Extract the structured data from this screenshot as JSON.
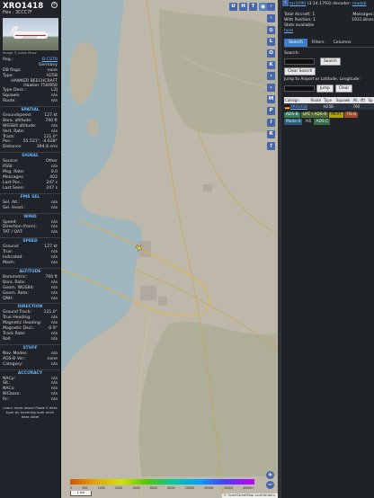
{
  "aircraft": {
    "callsign": "XRO1418",
    "hex_label": "Hex : 3CCC7F",
    "photo_credit": "Image © Julian Muse",
    "details": [
      {
        "k": "Reg.:",
        "v": "D-CSTB",
        "link": true
      },
      {
        "k": "",
        "v": "Germany"
      },
      {
        "k": "DB flags:",
        "v": "none"
      },
      {
        "k": "Type:",
        "v": "H25B"
      }
    ],
    "type_desc_line1": "HAWKER BEECHCRAFT",
    "type_desc_line2": "Hawker 750/850",
    "details2": [
      {
        "k": "Type Desc.:",
        "v": "L2J"
      },
      {
        "k": "Squawk:",
        "v": "n/a"
      },
      {
        "k": "Route:",
        "v": "n/a"
      }
    ]
  },
  "sections": [
    {
      "title": "SPATIAL",
      "rows": [
        {
          "k": "Groundspeed:",
          "v": "127 kt"
        },
        {
          "k": "Baro. altitude:",
          "v": "700 ft"
        },
        {
          "k": "WGS84 altitude:",
          "v": "n/a"
        },
        {
          "k": "Vert. Rate:",
          "v": "n/a"
        },
        {
          "k": "Track:",
          "v": "121.0°"
        },
        {
          "k": "Pos.:",
          "v": "55.521°, -4.628°"
        },
        {
          "k": "Distance:",
          "v": "394.8 nmi"
        }
      ]
    },
    {
      "title": "SIGNAL",
      "rows": [
        {
          "k": "Source:",
          "v": "Other"
        },
        {
          "k": "RSSI:",
          "v": "n/a"
        },
        {
          "k": "Msg. Rate:",
          "v": "0.0"
        },
        {
          "k": "Messages:",
          "v": "402"
        },
        {
          "k": "Last Pos.:",
          "v": "247 s"
        },
        {
          "k": "Last Seen:",
          "v": "247 s"
        }
      ]
    },
    {
      "title": "FMS SEL",
      "rows": [
        {
          "k": "Sel. Alt.:",
          "v": "n/a"
        },
        {
          "k": "Sel. Head.:",
          "v": "n/a"
        }
      ]
    },
    {
      "title": "WIND",
      "rows": [
        {
          "k": "Speed:",
          "v": "n/a"
        },
        {
          "k": "Direction (from):",
          "v": "n/a"
        },
        {
          "k": "TAT / OAT:",
          "v": "n/a"
        }
      ]
    },
    {
      "title": "SPEED",
      "rows": [
        {
          "k": "Ground:",
          "v": "127 kt"
        },
        {
          "k": "True:",
          "v": "n/a"
        },
        {
          "k": "Indicated:",
          "v": "n/a"
        },
        {
          "k": "Mach:",
          "v": "n/a"
        }
      ]
    },
    {
      "title": "ALTITUDE",
      "rows": [
        {
          "k": "Barometric:",
          "v": "700 ft"
        },
        {
          "k": "Baro. Rate:",
          "v": "n/a"
        },
        {
          "k": "Geom. WGS84:",
          "v": "n/a"
        },
        {
          "k": "Geom. Rate:",
          "v": "n/a"
        },
        {
          "k": "QNH:",
          "v": "n/a"
        }
      ]
    },
    {
      "title": "DIRECTION",
      "rows": [
        {
          "k": "Ground Track:",
          "v": "121.0°"
        },
        {
          "k": "True Heading:",
          "v": "n/a"
        },
        {
          "k": "Magnetic Heading:",
          "v": "n/a"
        },
        {
          "k": "Magnetic Decl.:",
          "v": "-0.9°"
        },
        {
          "k": "Track Rate:",
          "v": "n/a"
        },
        {
          "k": "Roll:",
          "v": "n/a"
        }
      ]
    },
    {
      "title": "STUFF",
      "rows": [
        {
          "k": "Nav. Modes:",
          "v": "n/a"
        },
        {
          "k": "ADS-B Ver.:",
          "v": "none"
        },
        {
          "k": "Category:",
          "v": "n/a"
        }
      ]
    },
    {
      "title": "ACCURACY",
      "rows": [
        {
          "k": "NACp:",
          "v": "n/a"
        },
        {
          "k": "SIL:",
          "v": "n/a"
        },
        {
          "k": "NACv:",
          "v": "n/a"
        },
        {
          "k": "NICbaro:",
          "v": "n/a"
        },
        {
          "k": "Rc:",
          "v": "n/a"
        }
      ]
    }
  ],
  "left_footer": "Learn more about Mode S data type by hovering over each data label",
  "map": {
    "top_buttons": [
      "U",
      "H",
      "T"
    ],
    "right_buttons": [
      "L",
      "O",
      "K",
      "M",
      "P",
      "I",
      "R"
    ],
    "legend_ticks": [
      "0",
      "500",
      "1000",
      "2000",
      "4000",
      "6000",
      "8000",
      "10000",
      "20000",
      "30000",
      "40000+"
    ],
    "scale_label": "1 km",
    "attribution": "© OpenStreetMap contributors."
  },
  "right_panel": {
    "top_link": "tar1090",
    "top_text": "(3.14.1793) decoder: ",
    "top_link2": "readsb",
    "stats": {
      "total_label": "Total Aircraft: 1",
      "messages_label": "Messages:",
      "messages_value": "1931.8/sec",
      "with_position": "With Position: 1",
      "stats_available": "Stats available",
      "stats_link": "here"
    },
    "tabs": [
      "Search",
      "Filters",
      "Columns"
    ],
    "search_label": "Search:",
    "search_button": "Search",
    "clear_search_button": "Clear Search",
    "jump_label": "Jump to Airport or Latitude, Longitude:",
    "jump_button": "Jump",
    "clear_button": "Clear",
    "table_headers": [
      "Callsign",
      "Route",
      "Type",
      "Squawk",
      "Alt. (ft)",
      "Sp"
    ],
    "table_row": {
      "callsign": "XRO1418",
      "route": "",
      "type": "H25B",
      "squawk": "",
      "alt": "700",
      "sp": ""
    },
    "sources": [
      "ADS-B",
      "UAT / ADS-R",
      "MLAT",
      "TIS-B",
      "Mode-S",
      "AIS",
      "ADS-C"
    ]
  }
}
